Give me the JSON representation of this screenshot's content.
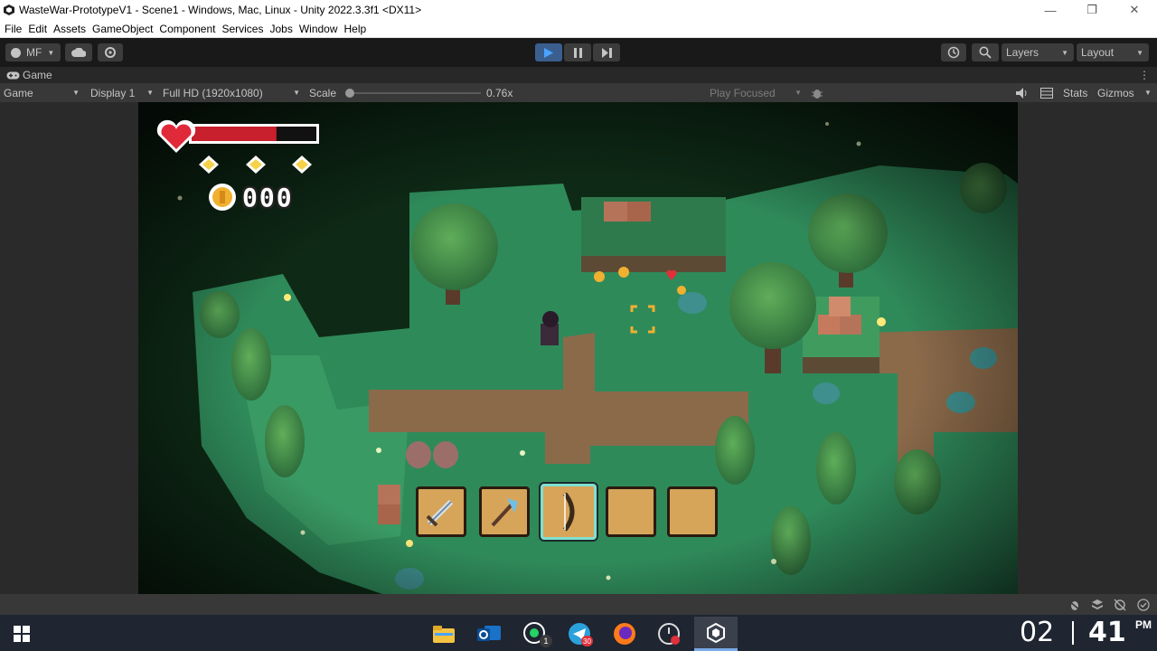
{
  "window": {
    "title": "WasteWar-PrototypeV1 - Scene1 - Windows, Mac, Linux - Unity 2022.3.3f1 <DX11>"
  },
  "menu": [
    "File",
    "Edit",
    "Assets",
    "GameObject",
    "Component",
    "Services",
    "Jobs",
    "Window",
    "Help"
  ],
  "toolbar": {
    "account": "MF",
    "layers": "Layers",
    "layout": "Layout"
  },
  "tab": {
    "label": "Game"
  },
  "game_toolbar": {
    "mode": "Game",
    "display": "Display 1",
    "resolution": "Full HD (1920x1080)",
    "scale_label": "Scale",
    "scale_value": "0.76x",
    "play_focused": "Play Focused",
    "stats": "Stats",
    "gizmos": "Gizmos"
  },
  "hud": {
    "health_fraction": 0.68,
    "coin_count": "000",
    "gem_count": 3,
    "hotbar": [
      "sword-icon",
      "axe-icon",
      "bow-icon",
      "",
      ""
    ],
    "selected_slot": 2
  },
  "clock": {
    "hour": "02",
    "minute": "41",
    "suffix": "PM"
  },
  "taskbar_badges": {
    "whatsapp": "1",
    "telegram": "30"
  },
  "colors": {
    "play_active": "#3a5f8f",
    "health": "#c8202c",
    "hotbar_selected": "#7fe0d2"
  }
}
